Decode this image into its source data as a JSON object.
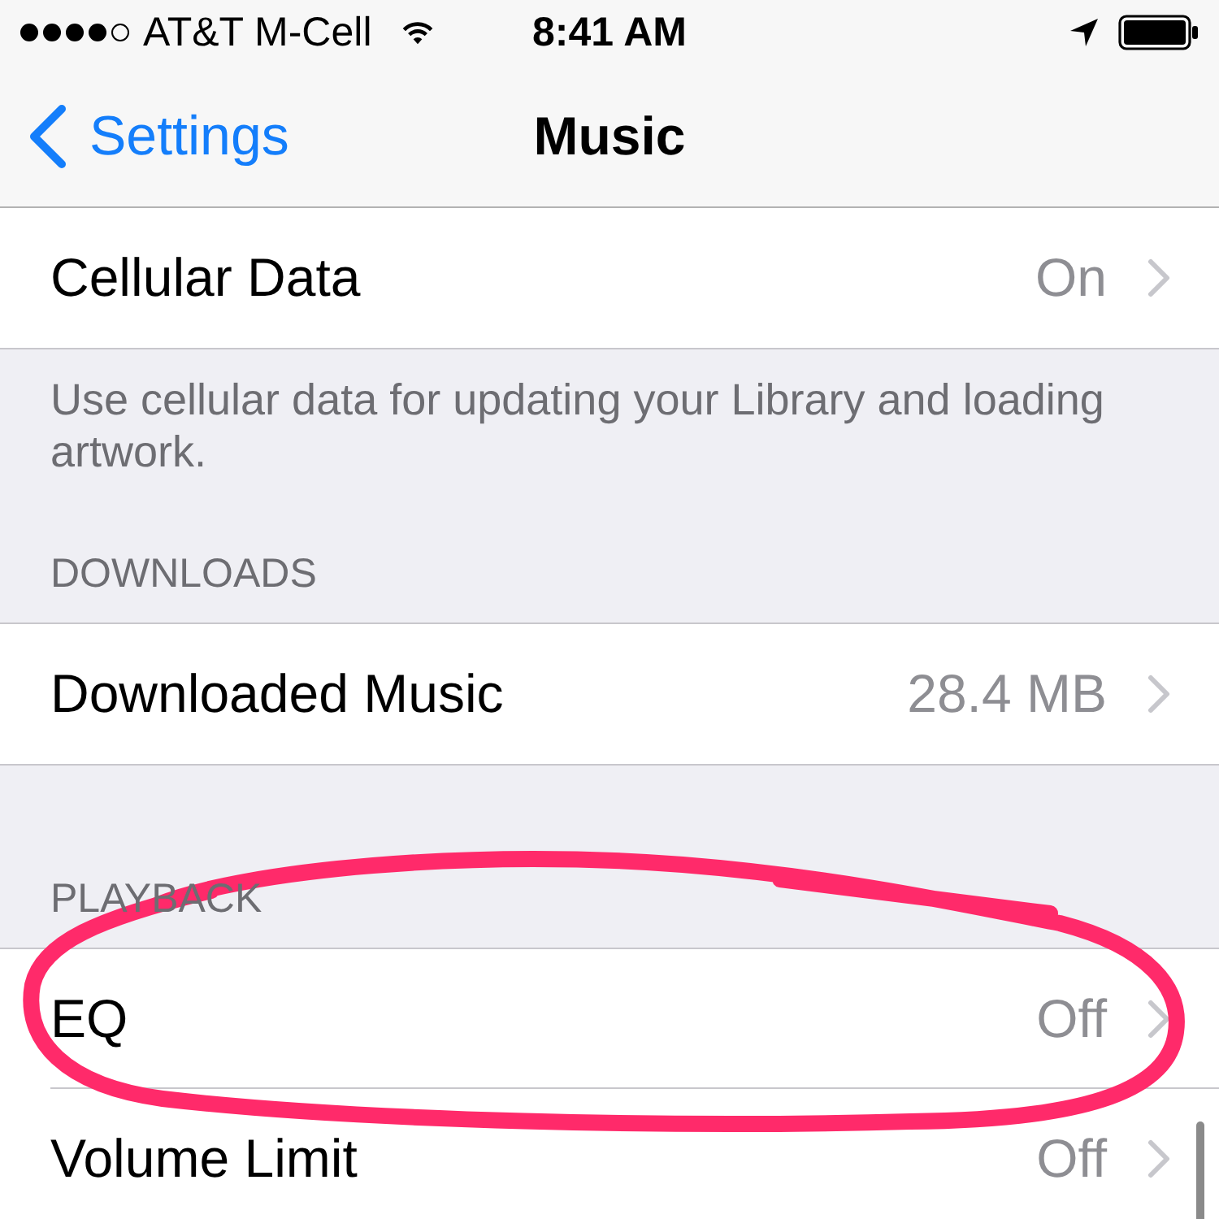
{
  "status_bar": {
    "carrier": "AT&T M-Cell",
    "time": "8:41 AM"
  },
  "nav_bar": {
    "back": "Settings",
    "title": "Music"
  },
  "sections": [
    {
      "rows": [
        {
          "label": "Cellular Data",
          "value": "On"
        }
      ],
      "footer": "Use cellular data for updating your Library and loading artwork."
    },
    {
      "header": "DOWNLOADS",
      "rows": [
        {
          "label": "Downloaded Music",
          "value": "28.4 MB"
        }
      ]
    },
    {
      "header": "PLAYBACK",
      "rows": [
        {
          "label": "EQ",
          "value": "Off"
        },
        {
          "label": "Volume Limit",
          "value": "Off"
        }
      ]
    }
  ]
}
